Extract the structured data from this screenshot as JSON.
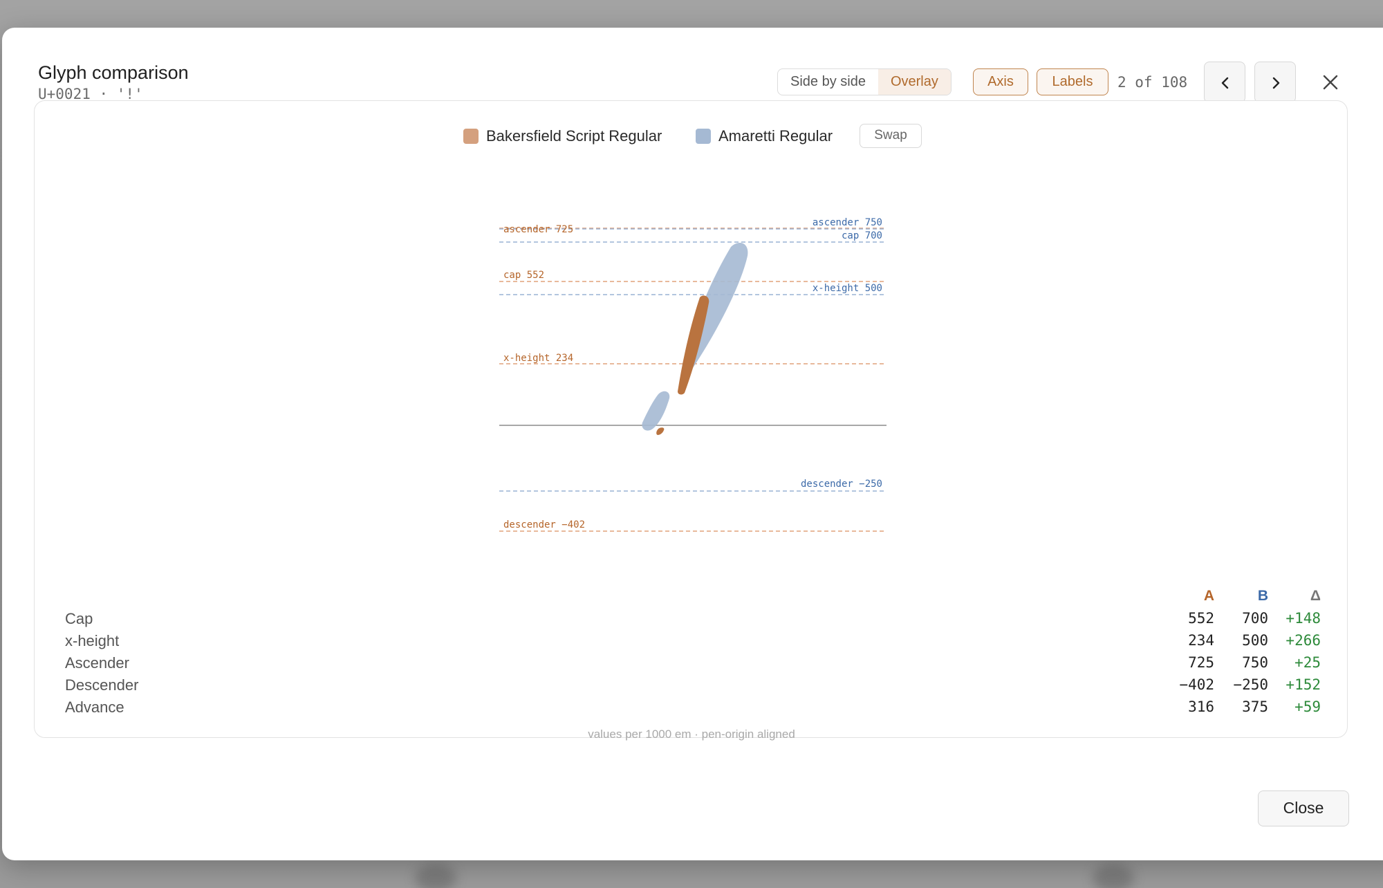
{
  "dialog": {
    "title": "Glyph comparison",
    "subtitle": "U+0021 · '!'",
    "view_modes": [
      "Side by side",
      "Overlay"
    ],
    "active_view_mode": "Overlay",
    "toggles": {
      "axis_label": "Axis",
      "labels_label": "Labels"
    },
    "pager": "2 of 108",
    "close_label": "Close"
  },
  "legend": {
    "font_a": "Bakersfield Script Regular",
    "font_b": "Amaretti Regular",
    "swap_label": "Swap",
    "color_a": "#d4a07e",
    "color_b": "#a5b9d3"
  },
  "glyph_metrics": {
    "font_a": {
      "ascender": "ascender 725",
      "cap": "cap 552",
      "x_height": "x-height 234",
      "descender": "descender −402"
    },
    "font_b": {
      "ascender": "ascender 750",
      "cap": "cap 700",
      "x_height": "x-height 500",
      "descender": "descender −250"
    }
  },
  "table": {
    "headers": {
      "a": "A",
      "b": "B",
      "delta": "Δ"
    },
    "rows": [
      {
        "name": "Cap",
        "a": "552",
        "b": "700",
        "delta": "+148"
      },
      {
        "name": "x-height",
        "a": "234",
        "b": "500",
        "delta": "+266"
      },
      {
        "name": "Ascender",
        "a": "725",
        "b": "750",
        "delta": "+25"
      },
      {
        "name": "Descender",
        "a": "−402",
        "b": "−250",
        "delta": "+152"
      },
      {
        "name": "Advance",
        "a": "316",
        "b": "375",
        "delta": "+59"
      }
    ],
    "footnote": "values per 1000 em · pen-origin aligned"
  },
  "colors": {
    "accent_a": "#b5652a",
    "accent_b": "#3c6aa8",
    "positive": "#2d8a3a"
  },
  "icons": {
    "prev": "chevron-left-icon",
    "next": "chevron-right-icon",
    "close": "close-icon"
  }
}
